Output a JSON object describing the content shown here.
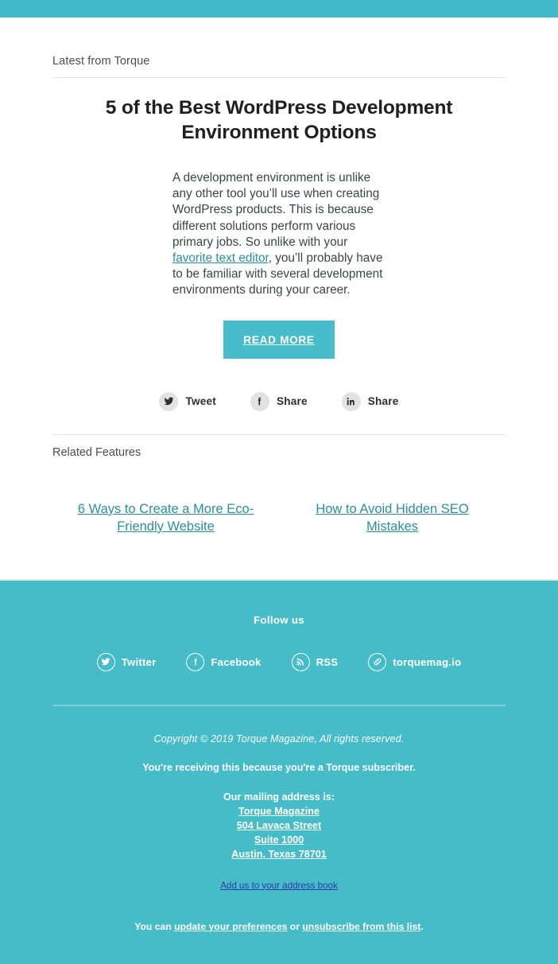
{
  "theme": {
    "teal": "#45bcc8",
    "teal_button": "#47bdcb",
    "link_teal": "#2b8f9c",
    "footer_rule": "#7ed0d8",
    "addressbook_link": "#2c3aa8",
    "badge_gray": "#e2e2e2"
  },
  "header": {
    "eyebrow": "Latest from Torque"
  },
  "article": {
    "title": "5 of the Best WordPress Development Environment Options",
    "body_part_1": "A development environment is unlike any other tool you’ll use when creating WordPress products. This is because different solutions perform various primary jobs. So unlike with your ",
    "body_link": "favorite text editor",
    "body_part_2": ", you’ll probably have to be familiar with several development environments during your career.",
    "cta_label": "READ MORE"
  },
  "share": {
    "items": [
      {
        "icon": "twitter-icon",
        "label": "Tweet"
      },
      {
        "icon": "facebook-icon",
        "label": "Share"
      },
      {
        "icon": "linkedin-icon",
        "label": "Share"
      }
    ]
  },
  "related": {
    "heading": "Related Features",
    "items": [
      {
        "label": "6 Ways to Create a More Eco-Friendly Website"
      },
      {
        "label": "How to Avoid Hidden SEO Mistakes"
      }
    ]
  },
  "footer": {
    "follow_title": "Follow us",
    "social": [
      {
        "icon": "twitter-icon",
        "label": "Twitter"
      },
      {
        "icon": "facebook-icon",
        "label": "Facebook"
      },
      {
        "icon": "rss-icon",
        "label": "RSS"
      },
      {
        "icon": "link-icon",
        "label": "torquemag.io"
      }
    ],
    "copyright": "Copyright © 2019 Torque Magazine, All rights reserved.",
    "subscriber_note": "You're receiving this because you're a Torque subscriber.",
    "address_title": "Our mailing address is:",
    "address_lines": [
      "Torque Magazine",
      "504 Lavaca Street",
      "Suite 1000",
      "Austin, Texas 78701"
    ],
    "address_book_link": "Add us to your address book",
    "prefs_prefix": "You can ",
    "prefs_link": "update your preferences",
    "prefs_middle": " or ",
    "unsub_link": "unsubscribe from this list",
    "prefs_suffix": "."
  }
}
